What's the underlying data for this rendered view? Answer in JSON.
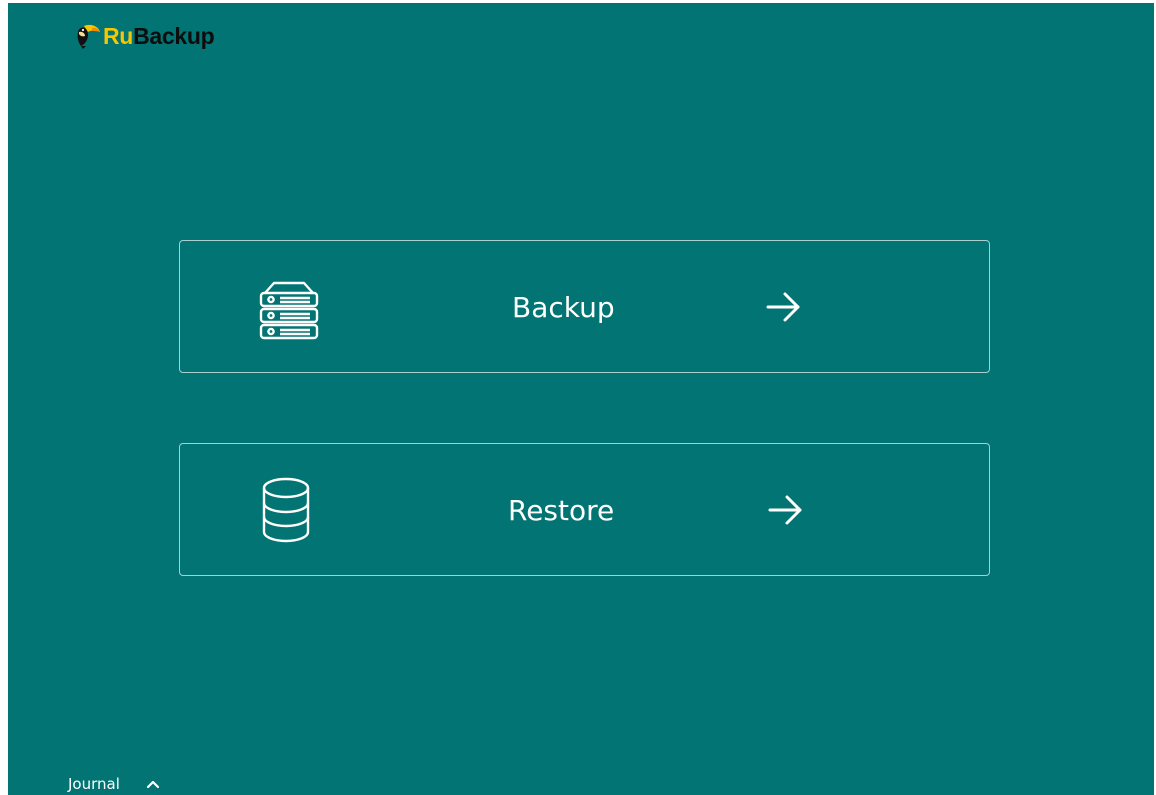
{
  "brand": {
    "name_prefix": "Ru",
    "name_suffix": "Backup",
    "logo_icon": "toucan-icon",
    "prefix_color": "#f7c600",
    "suffix_color": "#0d0d0d"
  },
  "theme": {
    "background": "#017473",
    "card_border": "#a9cfce",
    "text": "#ffffff"
  },
  "actions": [
    {
      "label": "Backup",
      "icon": "server-stack-icon",
      "arrow_icon": "arrow-right-icon"
    },
    {
      "label": "Restore",
      "icon": "database-icon",
      "arrow_icon": "arrow-right-icon"
    }
  ],
  "footer": {
    "journal_label": "Journal",
    "toggle_icon": "chevron-up-icon"
  }
}
